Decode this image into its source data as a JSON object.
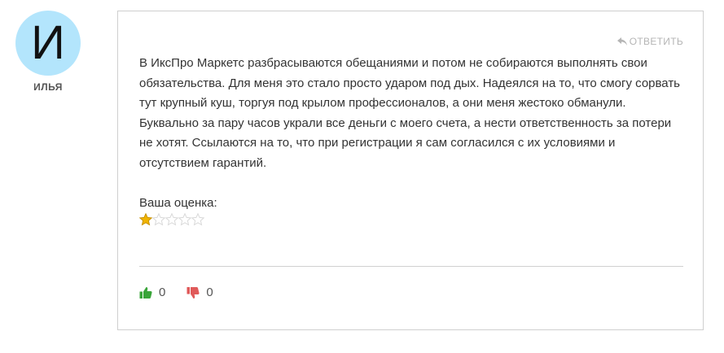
{
  "author": {
    "avatar_letter": "И",
    "name": "ИЛЬЯ"
  },
  "comment": {
    "reply_label": "ОТВЕТИТЬ",
    "text": "В ИксПро Маркетс разбрасываются обещаниями и потом не собираются выполнять свои обязательства. Для меня это стало просто ударом под дых. Надеялся на то, что смогу сорвать тут крупный куш, торгуя под крылом профессионалов, а они меня жестоко обманули. Буквально за пару часов украли все деньги с моего счета, а нести ответственность за потери не хотят. Ссылаются на то, что при регистрации я сам согласился с их условиями и отсутствием гарантий.",
    "rating_label": "Ваша оценка:",
    "rating": 1,
    "rating_max": 5
  },
  "votes": {
    "likes": "0",
    "dislikes": "0"
  },
  "colors": {
    "avatar_bg": "#b3e5fc",
    "like": "#3aa53a",
    "dislike": "#e05a5a",
    "star_filled": "#f0b400",
    "star_empty": "#d8d8d8"
  },
  "icons": {
    "reply": "reply-arrow-icon",
    "like": "thumbs-up-icon",
    "dislike": "thumbs-down-icon",
    "star": "star-icon"
  }
}
